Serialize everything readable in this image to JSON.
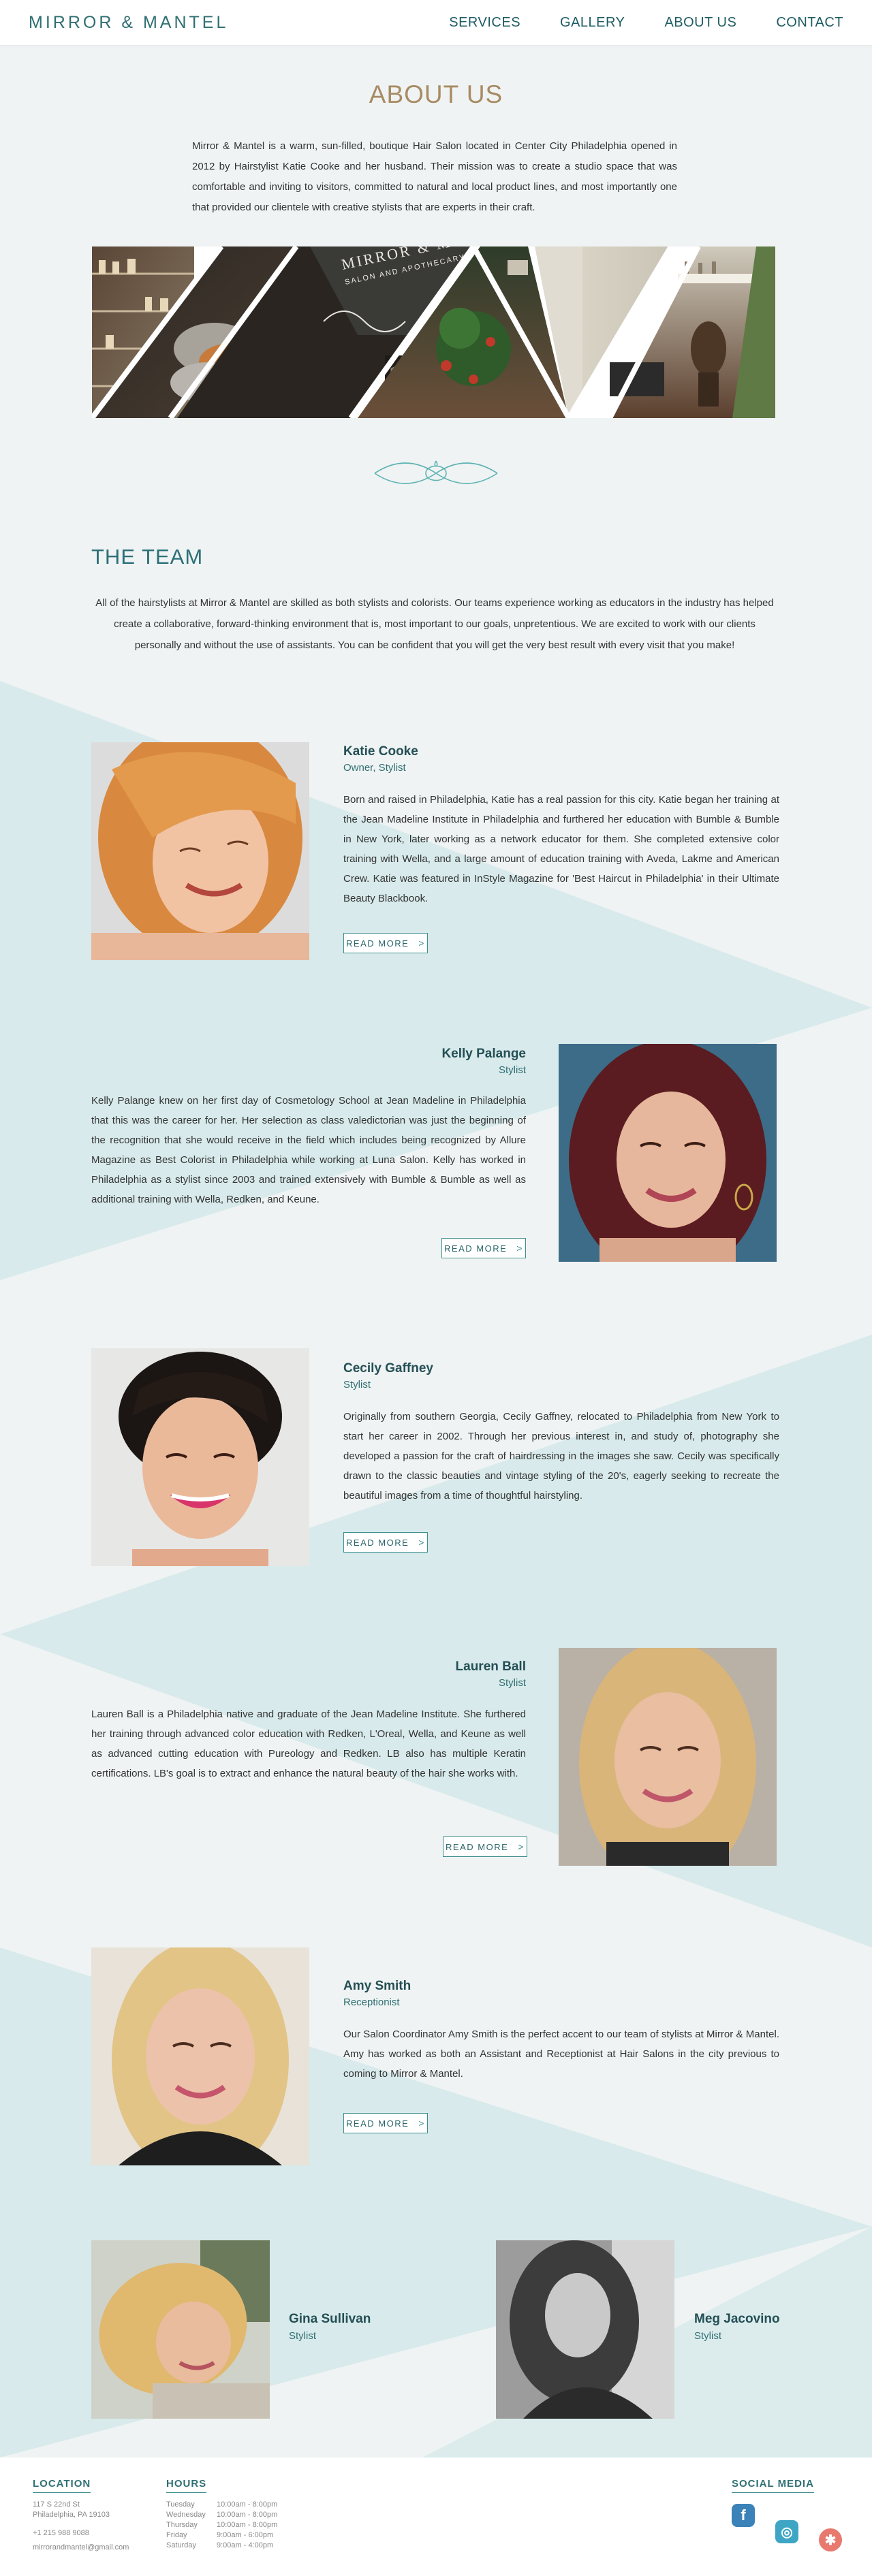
{
  "header": {
    "logo": "MIRROR & MANTEL",
    "nav": [
      "SERVICES",
      "GALLERY",
      "ABOUT US",
      "CONTACT"
    ]
  },
  "about": {
    "title": "ABOUT US",
    "text": "Mirror & Mantel is a warm, sun-filled, boutique Hair Salon located in Center City Philadelphia opened in 2012 by Hairstylist Katie Cooke and her husband. Their mission was to create a studio space that was comfortable and inviting to visitors, committed to natural and local product lines, and most importantly one that provided our clientele with creative stylists that are experts in their craft.",
    "collage_sign_line1": "MIRROR & MANTEL",
    "collage_sign_line2": "SALON AND APOTHECARY"
  },
  "team": {
    "title": "THE TEAM",
    "intro": "All of the hairstylists at Mirror & Mantel are skilled as both stylists and colorists. Our teams experience working as educators in the industry has helped create a collaborative, forward-thinking environment that is, most important to our goals, unpretentious. We are excited to work with our clients personally and without the use of assistants. You can be confident that you will get the very best result with every visit that you make!",
    "read_more": "READ MORE",
    "members": [
      {
        "name": "Katie Cooke",
        "role": "Owner, Stylist",
        "bio": "Born and raised in Philadelphia, Katie has a real passion for this city. Katie began her training at the Jean Madeline Institute in Philadelphia and furthered her education with Bumble & Bumble in New York, later working as a network educator for them. She completed extensive color training with Wella, and a large amount of education training with Aveda, Lakme and American Crew. Katie was featured in InStyle Magazine for 'Best Haircut in Philadelphia' in their Ultimate Beauty Blackbook."
      },
      {
        "name": "Kelly Palange",
        "role": "Stylist",
        "bio": "Kelly Palange knew on her first day of Cosmetology School at Jean Madeline in Philadelphia that this was the career for her. Her selection as class valedictorian was just the beginning of the recognition that she would receive in the field which includes being recognized by Allure Magazine as Best Colorist in Philadelphia while working at Luna Salon. Kelly has worked in Philadelphia as a stylist since 2003 and trained extensively with Bumble & Bumble as well as additional training with Wella, Redken, and Keune."
      },
      {
        "name": "Cecily Gaffney",
        "role": "Stylist",
        "bio": "Originally from southern Georgia, Cecily Gaffney, relocated to Philadelphia from New York to start her career in 2002. Through her previous interest in, and study of, photography she developed a passion for the craft of hairdressing in the images she saw. Cecily was specifically drawn to the classic beauties and vintage styling of the 20's, eagerly seeking to recreate the beautiful images from a time of thoughtful hairstyling."
      },
      {
        "name": "Lauren Ball",
        "role": "Stylist",
        "bio": "Lauren Ball is a Philadelphia native and graduate of the Jean Madeline Institute. She furthered her training through advanced color education with Redken, L'Oreal, Wella, and Keune as well as advanced cutting education with Pureology and Redken. LB also has multiple Keratin certifications. LB's goal is to extract and enhance the natural beauty of the hair she works with."
      },
      {
        "name": "Amy Smith",
        "role": "Receptionist",
        "bio": "Our Salon Coordinator Amy Smith is the perfect accent to our team of stylists at Mirror & Mantel. Amy has worked as both an Assistant and Receptionist at Hair Salons in the city previous to coming to Mirror & Mantel."
      },
      {
        "name": "Gina Sullivan",
        "role": "Stylist"
      },
      {
        "name": "Meg Jacovino",
        "role": "Stylist"
      }
    ]
  },
  "footer": {
    "location_title": "LOCATION",
    "address": [
      "117 S 22nd St",
      "Philadelphia, PA 19103",
      "+1 215 988 9088",
      "mirrorandmantel@gmail.com"
    ],
    "hours_title": "HOURS",
    "hours": [
      {
        "day": "Tuesday",
        "time": "10:00am - 8:00pm"
      },
      {
        "day": "Wednesday",
        "time": "10:00am - 8:00pm"
      },
      {
        "day": "Thursday",
        "time": "10:00am - 8:00pm"
      },
      {
        "day": "Friday",
        "time": "9:00am - 6:00pm"
      },
      {
        "day": "Saturday",
        "time": "9:00am - 4:00pm"
      }
    ],
    "social_title": "SOCIAL MEDIA",
    "social_glyphs": {
      "facebook": "f",
      "instagram": "◎",
      "yelp": "✱"
    }
  },
  "colors": {
    "accent": "#2f6f73",
    "title_gold": "#a88b63",
    "background_shape": "#d6e9ea",
    "facebook": "#3b82b8",
    "instagram": "#3ea6c4",
    "yelp": "#e8796e"
  }
}
